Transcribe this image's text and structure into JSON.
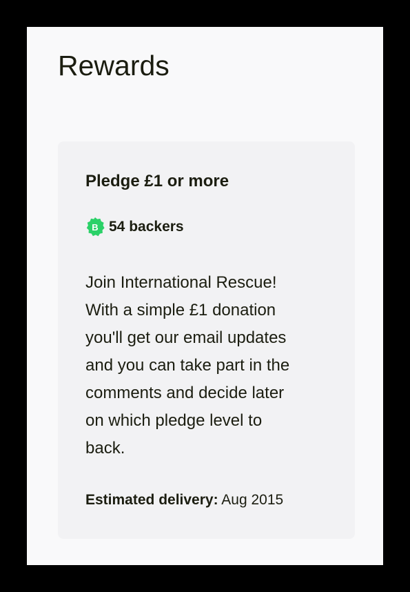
{
  "rewards": {
    "title": "Rewards"
  },
  "reward_card": {
    "pledge_title": "Pledge £1 or more",
    "backers_count": "54",
    "backers_label": "backers",
    "badge_icon": "backer-badge-icon",
    "badge_letter": "B",
    "badge_color": "#2bd168",
    "description_lines": [
      "Join International Rescue!",
      "With a simple £1 donation",
      "you'll get our email updates",
      "and you can take part in the",
      "comments and decide later",
      "on which pledge level to",
      "back."
    ],
    "delivery_label": "Estimated delivery:",
    "delivery_value": "Aug 2015"
  },
  "colors": {
    "frame": "#000000",
    "page_background": "#f9f9fa",
    "card_background": "#f2f2f4",
    "text": "#1b1d10",
    "badge_green": "#2bd168"
  }
}
